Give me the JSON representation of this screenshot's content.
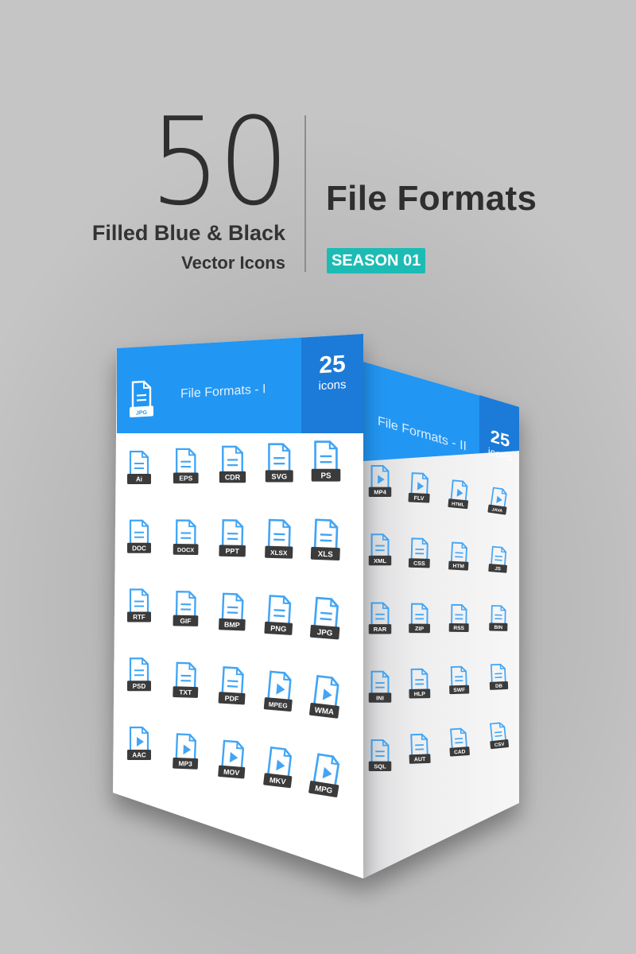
{
  "header": {
    "count": "50",
    "style_line": "Filled Blue & Black",
    "type_line": "Vector Icons",
    "title": "File Formats",
    "badge": "SEASON 01"
  },
  "colors": {
    "blue": "#2196f3",
    "blue_dark": "#1a7ad8",
    "icon_blue": "#42a5f5",
    "label_dark": "#3a3a3a",
    "badge_teal": "#1cbcb4",
    "text_dark": "#2f2f2f"
  },
  "panels": [
    {
      "name": "File Formats - I",
      "count": "25",
      "count_label": "icons",
      "header_icon_label": "JPG",
      "icons": [
        {
          "label": "Ai",
          "type": "doc"
        },
        {
          "label": "EPS",
          "type": "doc"
        },
        {
          "label": "CDR",
          "type": "doc"
        },
        {
          "label": "SVG",
          "type": "doc"
        },
        {
          "label": "PS",
          "type": "doc"
        },
        {
          "label": "DOC",
          "type": "doc"
        },
        {
          "label": "DOCX",
          "type": "doc"
        },
        {
          "label": "PPT",
          "type": "doc"
        },
        {
          "label": "XLSX",
          "type": "doc"
        },
        {
          "label": "XLS",
          "type": "doc"
        },
        {
          "label": "RTF",
          "type": "doc"
        },
        {
          "label": "GIF",
          "type": "doc"
        },
        {
          "label": "BMP",
          "type": "doc"
        },
        {
          "label": "PNG",
          "type": "doc"
        },
        {
          "label": "JPG",
          "type": "doc"
        },
        {
          "label": "PSD",
          "type": "doc"
        },
        {
          "label": "TXT",
          "type": "doc"
        },
        {
          "label": "PDF",
          "type": "doc"
        },
        {
          "label": "MPEG",
          "type": "media"
        },
        {
          "label": "WMA",
          "type": "media"
        },
        {
          "label": "AAC",
          "type": "media"
        },
        {
          "label": "MP3",
          "type": "media"
        },
        {
          "label": "MOV",
          "type": "media"
        },
        {
          "label": "MKV",
          "type": "media"
        },
        {
          "label": "MPG",
          "type": "media"
        }
      ]
    },
    {
      "name": "File Formats - II",
      "count": "25",
      "count_label": "icons",
      "icons": [
        {
          "label": "MP4",
          "type": "media"
        },
        {
          "label": "FLV",
          "type": "media"
        },
        {
          "label": "HTML",
          "type": "media"
        },
        {
          "label": "JAVA",
          "type": "media"
        },
        {
          "label": "XML",
          "type": "doc"
        },
        {
          "label": "CSS",
          "type": "doc"
        },
        {
          "label": "HTM",
          "type": "doc"
        },
        {
          "label": "JS",
          "type": "doc"
        },
        {
          "label": "RAR",
          "type": "doc"
        },
        {
          "label": "ZIP",
          "type": "doc"
        },
        {
          "label": "RSS",
          "type": "doc"
        },
        {
          "label": "BIN",
          "type": "doc"
        },
        {
          "label": "INI",
          "type": "doc"
        },
        {
          "label": "HLP",
          "type": "doc"
        },
        {
          "label": "SWF",
          "type": "doc"
        },
        {
          "label": "DB",
          "type": "doc"
        },
        {
          "label": "SQL",
          "type": "doc"
        },
        {
          "label": "AUT",
          "type": "doc"
        },
        {
          "label": "CAD",
          "type": "doc"
        },
        {
          "label": "CSV",
          "type": "doc"
        }
      ]
    }
  ]
}
